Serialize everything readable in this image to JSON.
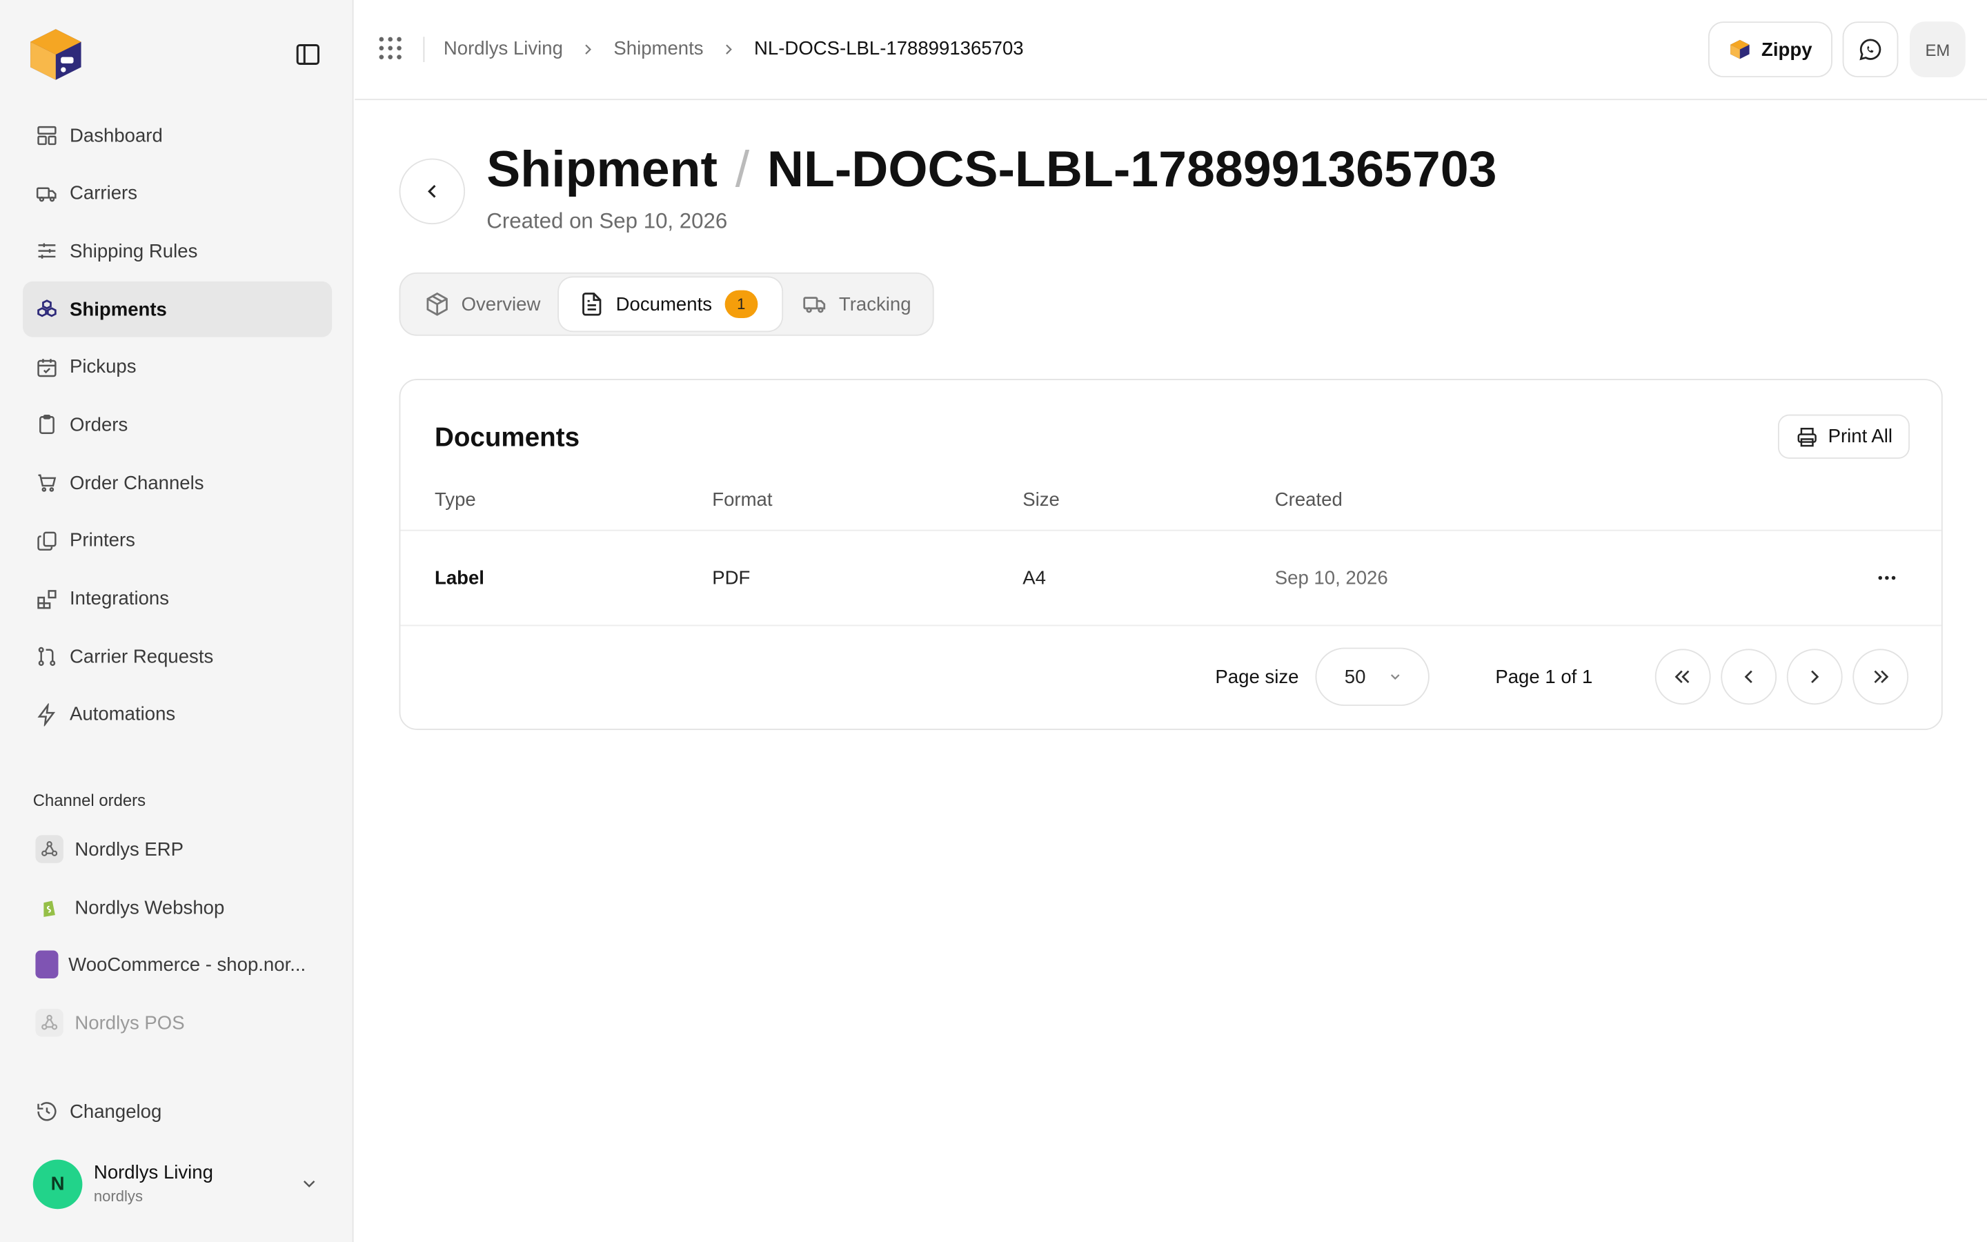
{
  "sidebar": {
    "nav": [
      {
        "label": "Dashboard",
        "icon": "dashboard-icon"
      },
      {
        "label": "Carriers",
        "icon": "truck-icon"
      },
      {
        "label": "Shipping Rules",
        "icon": "sliders-icon"
      },
      {
        "label": "Shipments",
        "icon": "boxes-icon",
        "active": true
      },
      {
        "label": "Pickups",
        "icon": "calendar-check-icon"
      },
      {
        "label": "Orders",
        "icon": "clipboard-icon"
      },
      {
        "label": "Order Channels",
        "icon": "cart-icon"
      },
      {
        "label": "Printers",
        "icon": "copy-icon"
      },
      {
        "label": "Integrations",
        "icon": "blocks-icon"
      },
      {
        "label": "Carrier Requests",
        "icon": "git-pull-icon"
      },
      {
        "label": "Automations",
        "icon": "zap-icon"
      }
    ],
    "channel_section_label": "Channel orders",
    "channels": [
      {
        "label": "Nordlys ERP",
        "icon": "webhook-icon"
      },
      {
        "label": "Nordlys Webshop",
        "icon": "shopify-icon"
      },
      {
        "label": "WooCommerce - shop.nor...",
        "icon": "woocommerce-icon"
      },
      {
        "label": "Nordlys POS",
        "icon": "webhook-icon",
        "disabled": true
      }
    ],
    "changelog_label": "Changelog",
    "account": {
      "initial": "N",
      "name": "Nordlys Living",
      "handle": "nordlys"
    }
  },
  "topbar": {
    "breadcrumb": [
      "Nordlys Living",
      "Shipments",
      "NL-DOCS-LBL-1788991365703"
    ],
    "zippy_label": "Zippy",
    "user_initials": "EM"
  },
  "page": {
    "title": "Shipment",
    "title_separator": "/",
    "shipment_id": "NL-DOCS-LBL-1788991365703",
    "created": "Created on Sep 10, 2026",
    "tabs": [
      {
        "label": "Overview",
        "icon": "package-icon"
      },
      {
        "label": "Documents",
        "icon": "file-text-icon",
        "badge": "1",
        "active": true
      },
      {
        "label": "Tracking",
        "icon": "truck-icon"
      }
    ]
  },
  "documents": {
    "title": "Documents",
    "print_all_label": "Print All",
    "columns": [
      "Type",
      "Format",
      "Size",
      "Created"
    ],
    "rows": [
      {
        "type": "Label",
        "format": "PDF",
        "size": "A4",
        "created": "Sep 10, 2026"
      }
    ],
    "page_size_label": "Page size",
    "page_size_value": "50",
    "page_info": "Page 1 of 1"
  },
  "colors": {
    "accent_badge": "#f59e0b",
    "avatar": "#22d38a",
    "logo_orange": "#f5a623",
    "logo_navy": "#2e2a7a"
  }
}
